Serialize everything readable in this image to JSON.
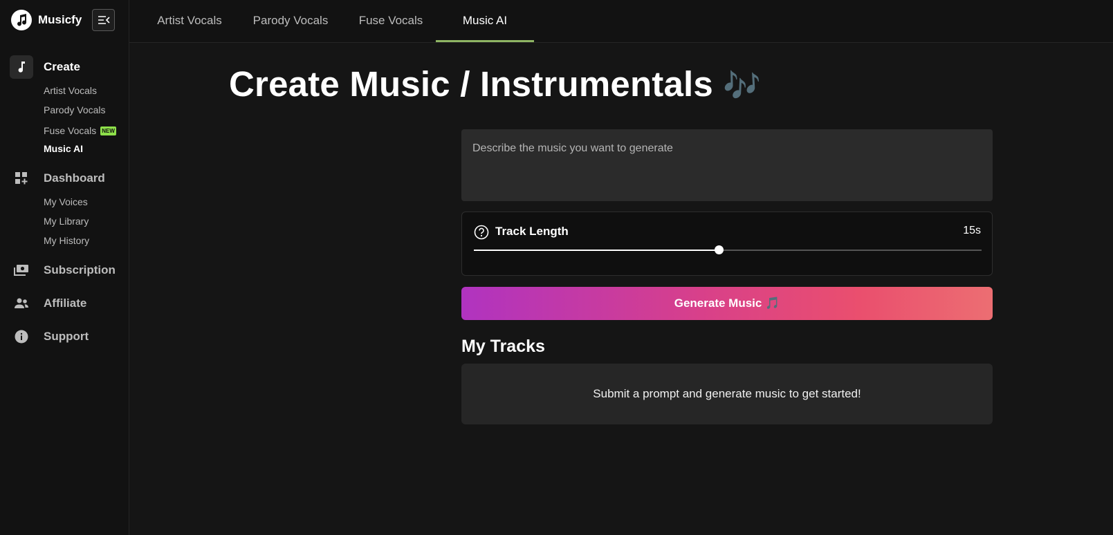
{
  "app": {
    "name": "Musicfy"
  },
  "tabs": [
    {
      "label": "Artist Vocals"
    },
    {
      "label": "Parody Vocals"
    },
    {
      "label": "Fuse Vocals"
    },
    {
      "label": "Music AI"
    }
  ],
  "sidebar": {
    "create": {
      "label": "Create",
      "items": [
        {
          "label": "Artist Vocals"
        },
        {
          "label": "Parody Vocals"
        },
        {
          "label": "Fuse Vocals",
          "badge": "NEW"
        },
        {
          "label": "Music AI"
        }
      ]
    },
    "dashboard": {
      "label": "Dashboard",
      "items": [
        {
          "label": "My Voices"
        },
        {
          "label": "My Library"
        },
        {
          "label": "My History"
        }
      ]
    },
    "subscription": {
      "label": "Subscription"
    },
    "affiliate": {
      "label": "Affiliate"
    },
    "support": {
      "label": "Support"
    }
  },
  "main": {
    "title": "Create Music / Instrumentals",
    "title_emoji": "🎶",
    "prompt_placeholder": "Describe the music you want to generate",
    "track_length": {
      "label": "Track Length",
      "value": "15s",
      "slider_fraction": 0.482
    },
    "generate_label": "Generate Music 🎵",
    "my_tracks_heading": "My Tracks",
    "empty_message": "Submit a prompt and generate music to get started!"
  },
  "colors": {
    "accent_underline": "#8fb564",
    "new_badge": "#8ee04a",
    "gradient_start": "#b033c0",
    "gradient_end": "#ec6e72"
  }
}
